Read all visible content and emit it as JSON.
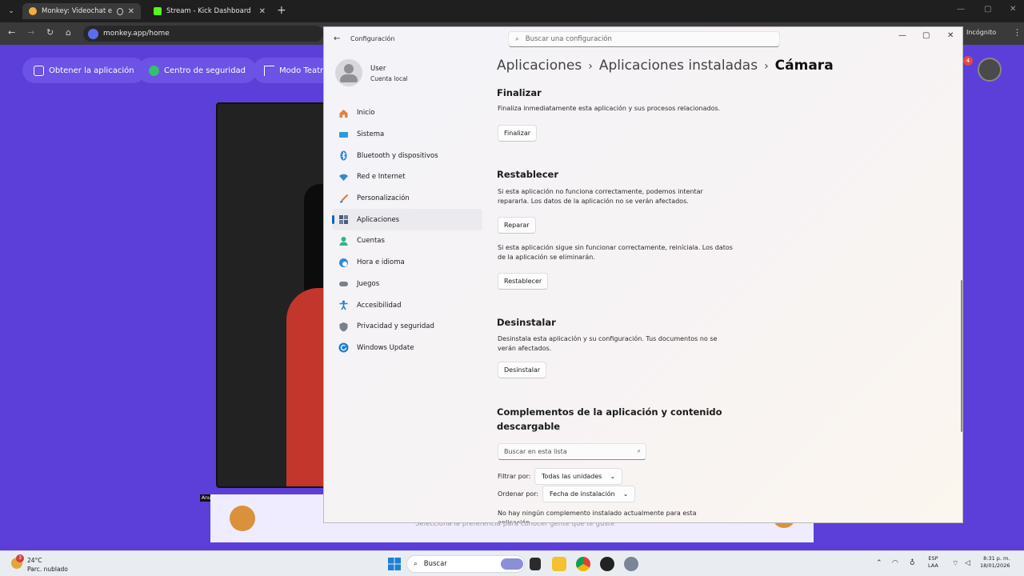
{
  "browser": {
    "tabs": [
      {
        "title": "Monkey: Videochat en vivo",
        "active": true,
        "favicon_color": "#f0b13c"
      },
      {
        "title": "Stream - Kick Dashboard",
        "active": false,
        "favicon_color": "#53fc18"
      }
    ],
    "url": "monkey.app/home",
    "incognito_label": "Incógnito"
  },
  "monkey": {
    "buttons": [
      "Obtener la aplicación",
      "Centro de seguridad",
      "Modo Teatro"
    ],
    "ad_label": "Anun",
    "hint": "Selecciona la preferencia para conocer gente que te guste",
    "notification_count": "4"
  },
  "settings": {
    "app_title": "Configuración",
    "search_placeholder": "Buscar una configuración",
    "user": {
      "name": "User",
      "account": "Cuenta local"
    },
    "nav": [
      {
        "label": "Inicio",
        "icon": "home-icon",
        "color": "#e5813a"
      },
      {
        "label": "Sistema",
        "icon": "system-icon",
        "color": "#2d9bd6"
      },
      {
        "label": "Bluetooth y dispositivos",
        "icon": "bluetooth-icon",
        "color": "#1f7fd4"
      },
      {
        "label": "Red e Internet",
        "icon": "wifi-icon",
        "color": "#2f8ad6"
      },
      {
        "label": "Personalización",
        "icon": "brush-icon",
        "color": "#d9833b"
      },
      {
        "label": "Aplicaciones",
        "icon": "apps-icon",
        "color": "#4b5d7a",
        "selected": true
      },
      {
        "label": "Cuentas",
        "icon": "account-icon",
        "color": "#2fb586"
      },
      {
        "label": "Hora e idioma",
        "icon": "clock-globe-icon",
        "color": "#2f8ad6"
      },
      {
        "label": "Juegos",
        "icon": "controller-icon",
        "color": "#7a7f8a"
      },
      {
        "label": "Accesibilidad",
        "icon": "accessibility-icon",
        "color": "#1f7fd4"
      },
      {
        "label": "Privacidad y seguridad",
        "icon": "shield-icon",
        "color": "#7a7f8a"
      },
      {
        "label": "Windows Update",
        "icon": "update-icon",
        "color": "#1f7fd4"
      }
    ],
    "breadcrumb": {
      "level1": "Aplicaciones",
      "level2": "Aplicaciones instaladas",
      "current": "Cámara"
    },
    "finalizar": {
      "title": "Finalizar",
      "text": "Finaliza inmediatamente esta aplicación y sus procesos relacionados.",
      "button": "Finalizar"
    },
    "restablecer": {
      "title": "Restablecer",
      "text1": "Si esta aplicación no funciona correctamente, podemos intentar repararla. Los datos de la aplicación no se verán afectados.",
      "repair_button": "Reparar",
      "text2": "Si esta aplicación sigue sin funcionar correctamente, reiníciala. Los datos de la aplicación se eliminarán.",
      "reset_button": "Restablecer"
    },
    "desinstalar": {
      "title": "Desinstalar",
      "text": "Desinstala esta aplicación y su configuración. Tus documentos no se verán afectados.",
      "button": "Desinstalar"
    },
    "addons": {
      "title": "Complementos de la aplicación y contenido descargable",
      "search_placeholder": "Buscar en esta lista",
      "filter_label": "Filtrar por:",
      "filter_value": "Todas las unidades",
      "sort_label": "Ordenar por:",
      "sort_value": "Fecha de instalación",
      "empty_text": "No hay ningún complemento instalado actualmente para esta aplicación"
    }
  },
  "taskbar": {
    "weather_temp": "24°C",
    "weather_desc": "Parc. nublado",
    "weather_badge": "3",
    "search_label": "Buscar",
    "lang1": "ESP",
    "lang2": "LAA",
    "time": "8:31 p. m.",
    "date": "18/01/2026"
  }
}
